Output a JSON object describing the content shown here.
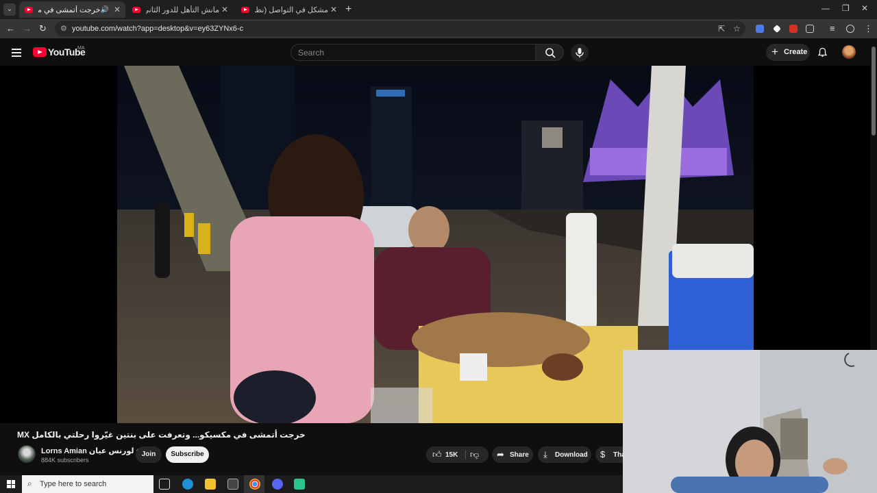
{
  "browser": {
    "tabs": [
      {
        "title": "خرجت أتمشى في مكسيكو...",
        "active": true,
        "sound": true
      },
      {
        "title": "مانش التأهل للدور الثاني؟ (التسك)"
      },
      {
        "title": "مشكل في التواصل (نظرية البراق..."
      }
    ],
    "new_tab": "+",
    "url": "youtube.com/watch?app=desktop&v=ey63ZYNx6-c"
  },
  "youtube": {
    "logo_text": "YouTube",
    "country_code": "MA",
    "search_placeholder": "Search",
    "create_label": "Create"
  },
  "video": {
    "title": "خرجت أتمشى في مكسيكو... وتعرفت على بنتين غيّروا رحلتي بالكامل MX",
    "channel": {
      "name": "Lorns Amian لورنس عيان",
      "subscribers": "884K subscribers"
    },
    "join_label": "Join",
    "subscribe_label": "Subscribe",
    "likes": "15K",
    "share_label": "Share",
    "download_label": "Download",
    "thanks_label": "Tha"
  },
  "taskbar": {
    "search_placeholder": "Type here to search"
  },
  "colors": {
    "youtube_red": "#ff0033",
    "background": "#0f0f0f",
    "pill": "#272727"
  }
}
